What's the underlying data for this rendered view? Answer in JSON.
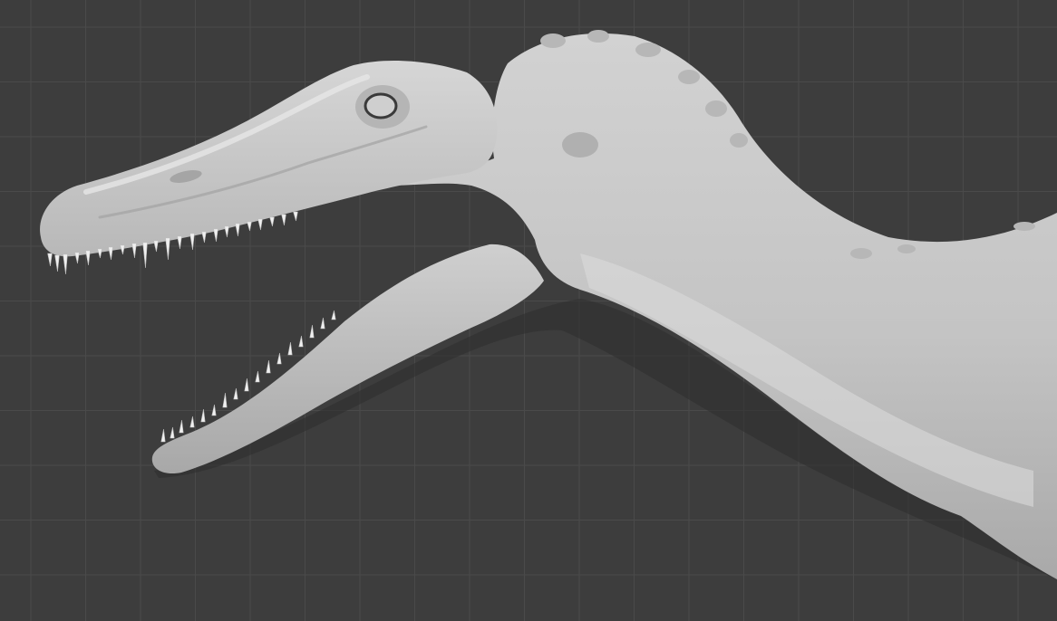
{
  "viewport": {
    "background_color": "#3d3d3d",
    "grid_color": "#4a4a4a",
    "mesh_color": "#c8c8c8",
    "mesh_highlight_color": "#e0e0e0",
    "mesh_shadow_color": "#8f8f8f",
    "tooth_color": "#f0f0f0",
    "icon": "sculpt-mesh-icon"
  }
}
